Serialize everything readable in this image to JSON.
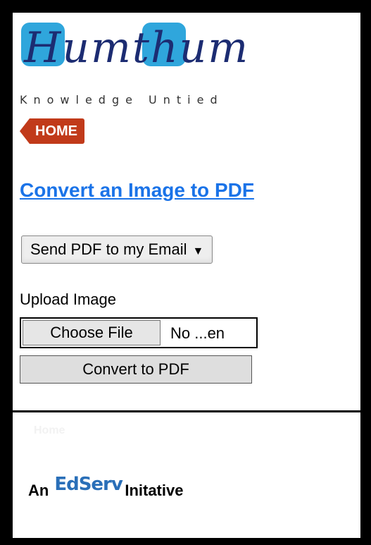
{
  "logo": {
    "word": "Humthum",
    "tagline": "Knowledge Untied"
  },
  "nav": {
    "home_label": "HOME"
  },
  "page": {
    "title": "Convert an Image to PDF"
  },
  "form": {
    "delivery_select": "Send PDF to my Email",
    "upload_label": "Upload Image",
    "choose_file_label": "Choose File",
    "file_name": "No ...en",
    "convert_label": "Convert to PDF"
  },
  "footer": {
    "faint_text": "Home",
    "initiative_prefix": "An",
    "initiative_logo": "EdServ",
    "initiative_suffix": "Initative"
  }
}
